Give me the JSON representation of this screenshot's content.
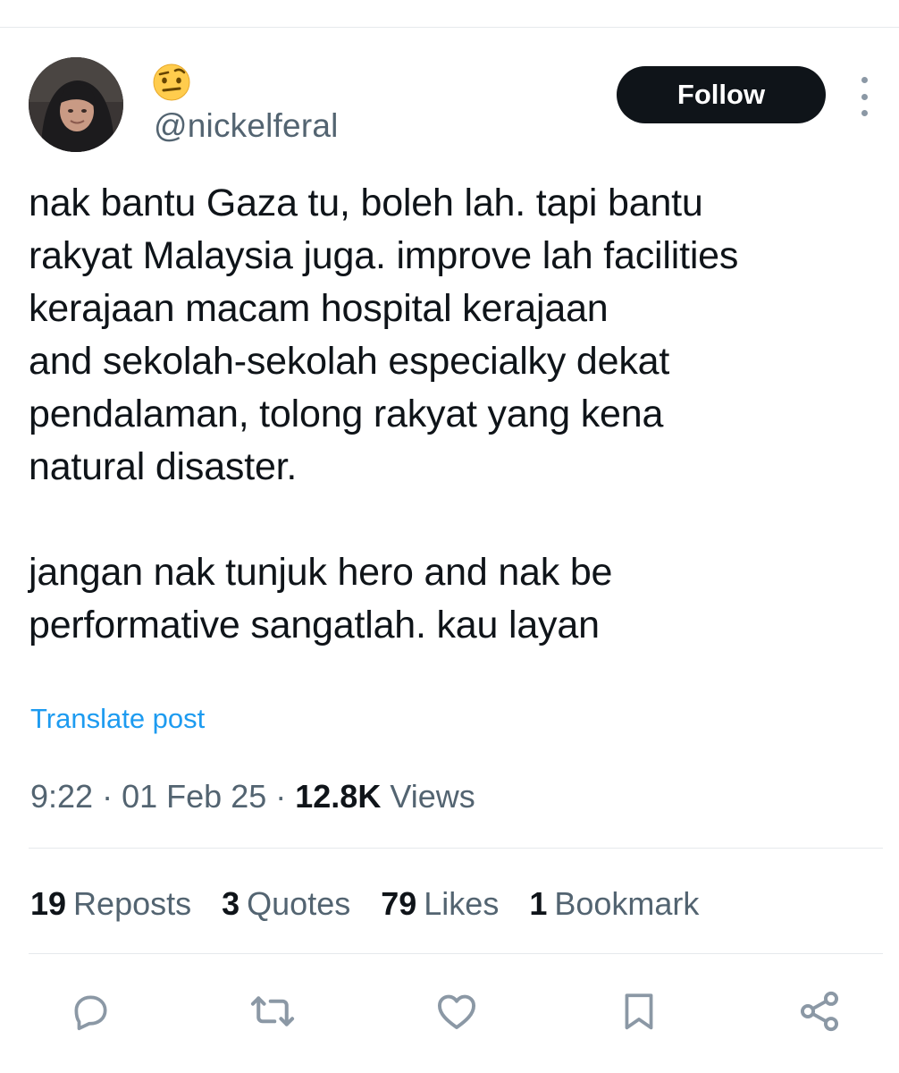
{
  "author": {
    "handle": "@nickelferal",
    "display_name_icon": "raised-eyebrow-emoji",
    "avatar_icon": "profile-photo"
  },
  "follow_label": "Follow",
  "more_icon": "more-vertical-icon",
  "post": {
    "lines": [
      "nak bantu Gaza tu, boleh lah. tapi bantu",
      "rakyat Malaysia juga. improve lah facilities",
      "kerajaan macam hospital kerajaan",
      "and sekolah-sekolah especialky dekat",
      "pendalaman, tolong rakyat yang kena",
      "natural disaster.",
      "",
      "jangan nak tunjuk hero and nak be",
      "performative sangatlah. kau layan"
    ]
  },
  "translate_label": "Translate post",
  "meta": {
    "time": "9:22",
    "date": "01 Feb 25",
    "views_count": "12.8K",
    "views_label": "Views",
    "separator": "·"
  },
  "stats": [
    {
      "count": "19",
      "label": "Reposts"
    },
    {
      "count": "3",
      "label": "Quotes"
    },
    {
      "count": "79",
      "label": "Likes"
    },
    {
      "count": "1",
      "label": "Bookmark"
    }
  ],
  "actions": [
    "reply-icon",
    "repost-icon",
    "like-icon",
    "bookmark-icon",
    "share-icon"
  ],
  "colors": {
    "text": "#0f1419",
    "secondary": "#536471",
    "link": "#1d9bf0",
    "follow_bg": "#0f1419",
    "icon": "#8b98a5",
    "divider": "#e6e9ec"
  }
}
